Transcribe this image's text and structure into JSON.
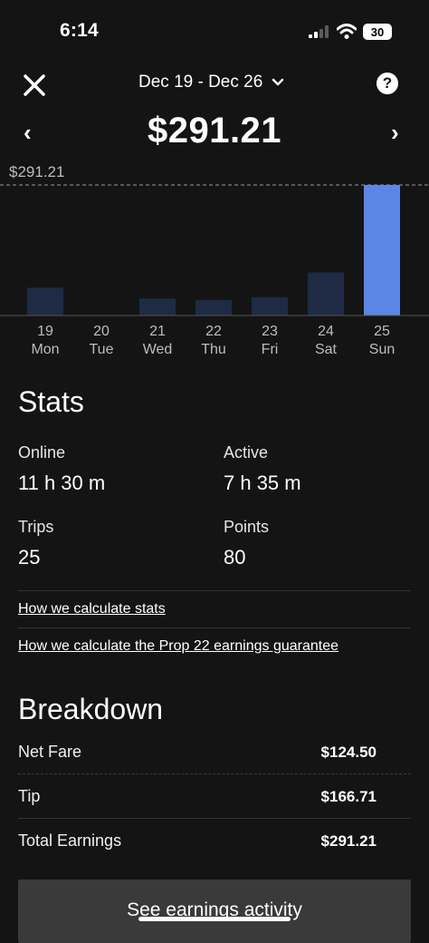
{
  "status_bar": {
    "time": "6:14",
    "battery": "30"
  },
  "header": {
    "date_range": "Dec 19 - Dec 26",
    "total": "$291.21",
    "prev_symbol": "‹",
    "next_symbol": "›",
    "help_symbol": "?"
  },
  "chart_data": {
    "type": "bar",
    "reference_label": "$291.21",
    "reference_value": 291.21,
    "categories": [
      {
        "day": "19",
        "weekday": "Mon"
      },
      {
        "day": "20",
        "weekday": "Tue"
      },
      {
        "day": "21",
        "weekday": "Wed"
      },
      {
        "day": "22",
        "weekday": "Thu"
      },
      {
        "day": "23",
        "weekday": "Fri"
      },
      {
        "day": "24",
        "weekday": "Sat"
      },
      {
        "day": "25",
        "weekday": "Sun"
      }
    ],
    "values": [
      62,
      0,
      38,
      35,
      41,
      96,
      291.21
    ],
    "highlight_index": 6,
    "colors": {
      "bar": "#1f2a44",
      "highlight": "#5b86e5",
      "axis": "#555555"
    }
  },
  "stats": {
    "title": "Stats",
    "online_label": "Online",
    "online_value": "11 h 30 m",
    "active_label": "Active",
    "active_value": "7 h 35 m",
    "trips_label": "Trips",
    "trips_value": "25",
    "points_label": "Points",
    "points_value": "80",
    "link_stats": "How we calculate stats",
    "link_prop22": "How we calculate the Prop 22 earnings guarantee"
  },
  "breakdown": {
    "title": "Breakdown",
    "rows": [
      {
        "label": "Net Fare",
        "value": "$124.50"
      },
      {
        "label": "Tip",
        "value": "$166.71"
      },
      {
        "label": "Total Earnings",
        "value": "$291.21"
      }
    ]
  },
  "cta_label": "See earnings activity"
}
